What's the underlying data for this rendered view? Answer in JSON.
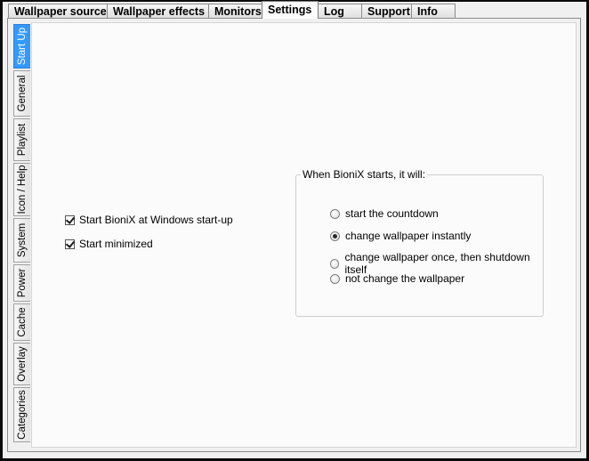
{
  "top_tabs": [
    {
      "label": "Wallpaper source"
    },
    {
      "label": "Wallpaper effects"
    },
    {
      "label": "Monitors"
    },
    {
      "label": "Settings"
    },
    {
      "label": "Log"
    },
    {
      "label": "Support"
    },
    {
      "label": "Info"
    }
  ],
  "side_tabs": [
    {
      "label": "Start Up"
    },
    {
      "label": "General"
    },
    {
      "label": "Playlist"
    },
    {
      "label": "Icon / Help"
    },
    {
      "label": "System"
    },
    {
      "label": "Power"
    },
    {
      "label": "Cache"
    },
    {
      "label": "Overlay"
    },
    {
      "label": "Categories"
    }
  ],
  "startup": {
    "start_with_windows": {
      "label": "Start BioniX at Windows start-up",
      "checked": true
    },
    "start_minimized": {
      "label": "Start minimized",
      "checked": true
    }
  },
  "on_start_group": {
    "title": "When BioniX starts, it will:",
    "options": [
      {
        "label": "start the countdown",
        "selected": false
      },
      {
        "label": "change wallpaper instantly",
        "selected": true
      },
      {
        "label": "change wallpaper once, then shutdown itself",
        "selected": false
      },
      {
        "label": "not change the wallpaper",
        "selected": false
      }
    ]
  }
}
